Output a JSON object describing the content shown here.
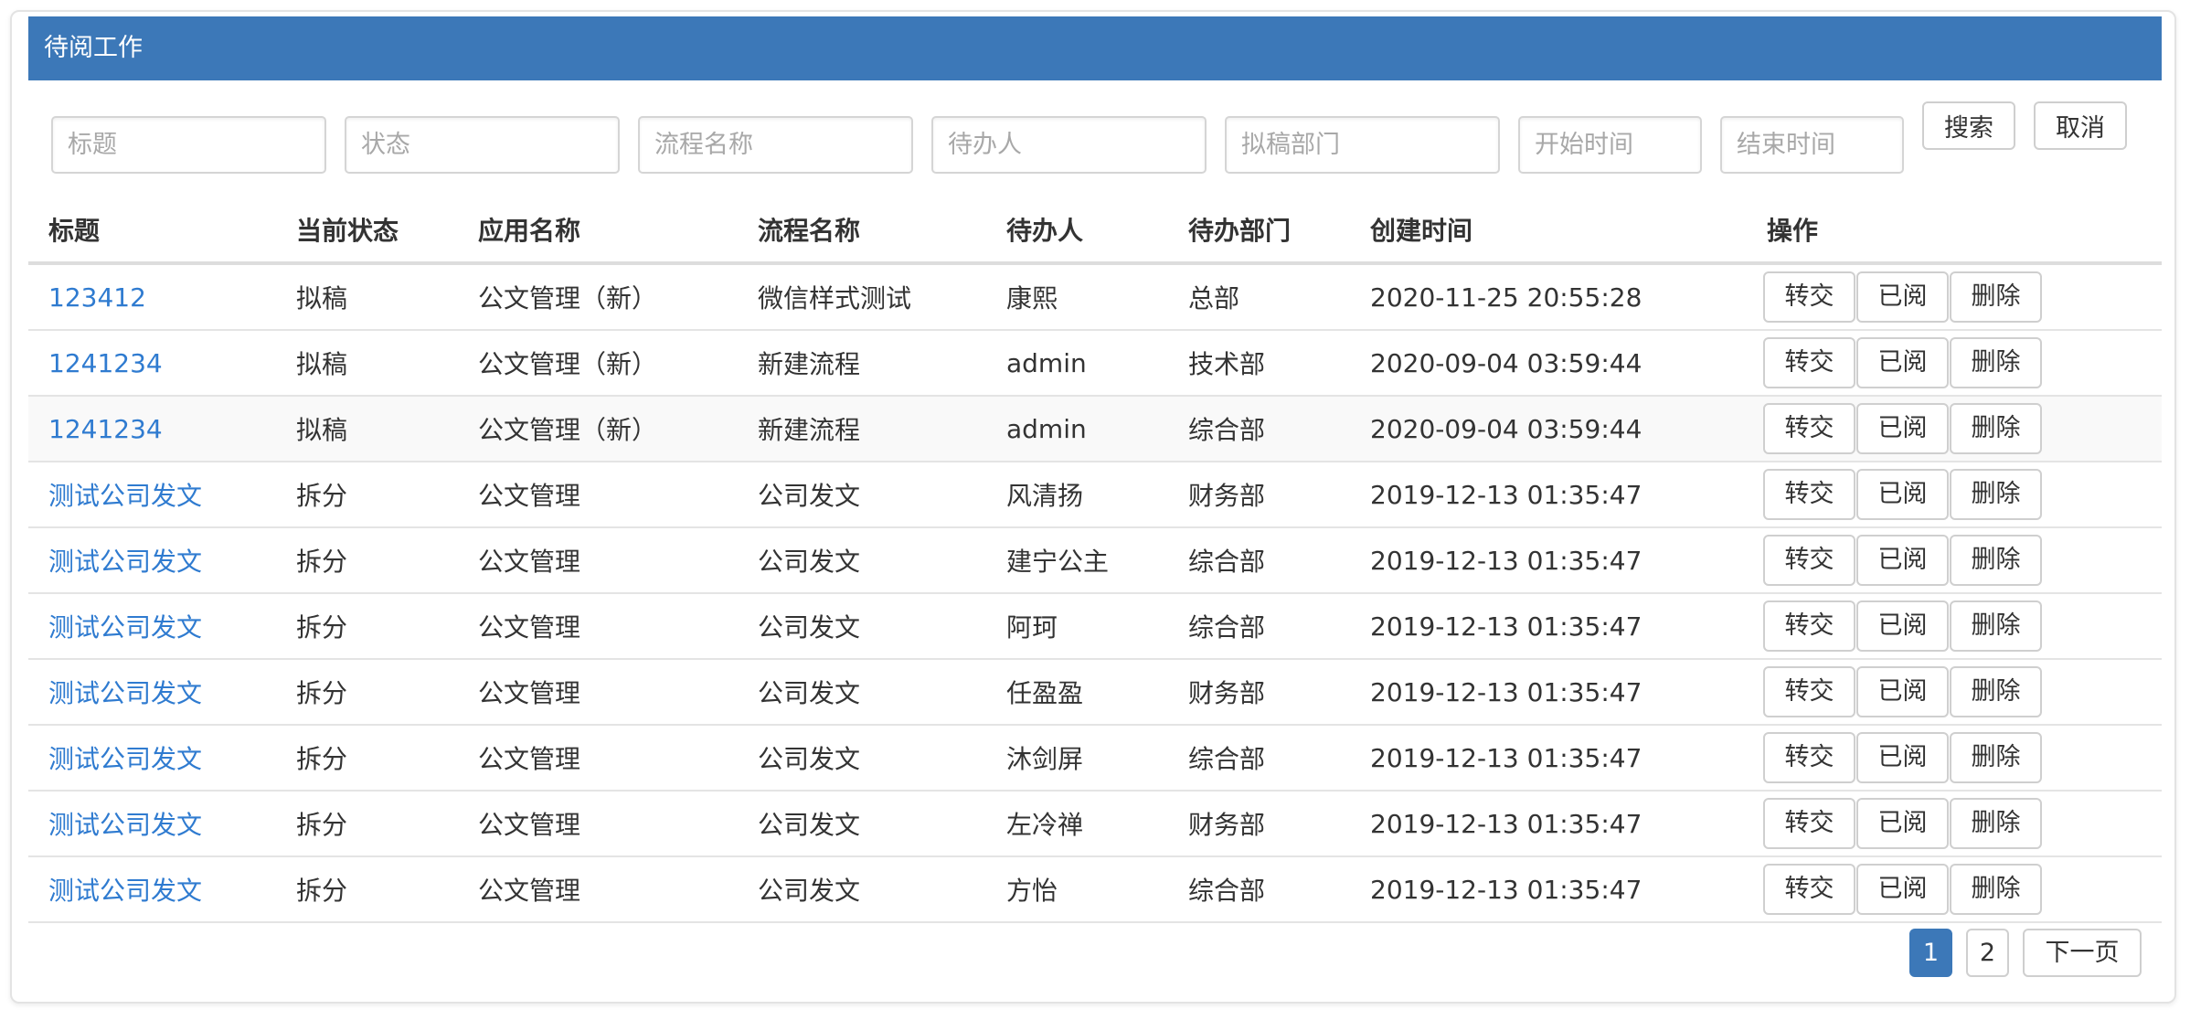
{
  "panel": {
    "title": "待阅工作"
  },
  "filters": {
    "title_placeholder": "标题",
    "status_placeholder": "状态",
    "flow_placeholder": "流程名称",
    "assignee_placeholder": "待办人",
    "dept_placeholder": "拟稿部门",
    "start_placeholder": "开始时间",
    "end_placeholder": "结束时间",
    "search_label": "搜索",
    "cancel_label": "取消"
  },
  "table": {
    "headers": [
      "标题",
      "当前状态",
      "应用名称",
      "流程名称",
      "待办人",
      "待办部门",
      "创建时间",
      "操作"
    ],
    "actions": [
      "转交",
      "已阅",
      "删除"
    ],
    "rows": [
      {
        "title": "123412",
        "status": "拟稿",
        "app": "公文管理（新）",
        "flow": "微信样式测试",
        "assignee": "康熙",
        "dept": "总部",
        "created": "2020-11-25 20:55:28"
      },
      {
        "title": "1241234",
        "status": "拟稿",
        "app": "公文管理（新）",
        "flow": "新建流程",
        "assignee": "admin",
        "dept": "技术部",
        "created": "2020-09-04 03:59:44"
      },
      {
        "title": "1241234",
        "status": "拟稿",
        "app": "公文管理（新）",
        "flow": "新建流程",
        "assignee": "admin",
        "dept": "综合部",
        "created": "2020-09-04 03:59:44"
      },
      {
        "title": "测试公司发文",
        "status": "拆分",
        "app": "公文管理",
        "flow": "公司发文",
        "assignee": "风清扬",
        "dept": "财务部",
        "created": "2019-12-13 01:35:47"
      },
      {
        "title": "测试公司发文",
        "status": "拆分",
        "app": "公文管理",
        "flow": "公司发文",
        "assignee": "建宁公主",
        "dept": "综合部",
        "created": "2019-12-13 01:35:47"
      },
      {
        "title": "测试公司发文",
        "status": "拆分",
        "app": "公文管理",
        "flow": "公司发文",
        "assignee": "阿珂",
        "dept": "综合部",
        "created": "2019-12-13 01:35:47"
      },
      {
        "title": "测试公司发文",
        "status": "拆分",
        "app": "公文管理",
        "flow": "公司发文",
        "assignee": "任盈盈",
        "dept": "财务部",
        "created": "2019-12-13 01:35:47"
      },
      {
        "title": "测试公司发文",
        "status": "拆分",
        "app": "公文管理",
        "flow": "公司发文",
        "assignee": "沐剑屏",
        "dept": "综合部",
        "created": "2019-12-13 01:35:47"
      },
      {
        "title": "测试公司发文",
        "status": "拆分",
        "app": "公文管理",
        "flow": "公司发文",
        "assignee": "左冷禅",
        "dept": "财务部",
        "created": "2019-12-13 01:35:47"
      },
      {
        "title": "测试公司发文",
        "status": "拆分",
        "app": "公文管理",
        "flow": "公司发文",
        "assignee": "方怡",
        "dept": "综合部",
        "created": "2019-12-13 01:35:47"
      }
    ]
  },
  "pagination": {
    "page1": "1",
    "page2": "2",
    "next_label": "下一页"
  }
}
